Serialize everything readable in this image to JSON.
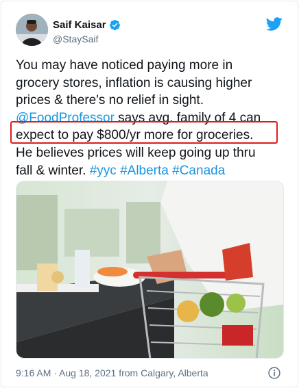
{
  "tweet": {
    "author_name": "Saif Kaisar",
    "author_handle": "@StaySaif",
    "text_lines": [
      {
        "parts": [
          {
            "t": "You may have noticed paying more in",
            "link": false
          }
        ]
      },
      {
        "parts": [
          {
            "t": "grocery stores, inflation is causing higher",
            "link": false
          }
        ]
      },
      {
        "parts": [
          {
            "t": "prices & there's no relief in sight.",
            "link": false
          }
        ]
      },
      {
        "parts": [
          {
            "t": "@FoodProfessor",
            "link": true
          },
          {
            "t": " says avg. family of 4 can",
            "link": false
          }
        ]
      },
      {
        "parts": [
          {
            "t": "expect to pay $800/yr more for groceries.",
            "link": false
          }
        ]
      },
      {
        "parts": [
          {
            "t": "He believes prices will keep going up thru",
            "link": false
          }
        ]
      },
      {
        "parts": [
          {
            "t": "fall & winter. ",
            "link": false
          },
          {
            "t": "#yyc",
            "link": true
          },
          {
            "t": " ",
            "link": false
          },
          {
            "t": "#Alberta",
            "link": true
          },
          {
            "t": " ",
            "link": false
          },
          {
            "t": "#Canada",
            "link": true
          }
        ]
      }
    ],
    "timestamp": "9:16 AM · Aug 18, 2021 from Calgary, Alberta"
  },
  "colors": {
    "link": "#1b95e0",
    "verified": "#1da1f2",
    "highlight_box": "#e01a1a",
    "meta_text": "#5b7083"
  },
  "icons": {
    "verified": "verified-badge-icon",
    "brand": "twitter-bird-icon",
    "info": "info-icon"
  }
}
